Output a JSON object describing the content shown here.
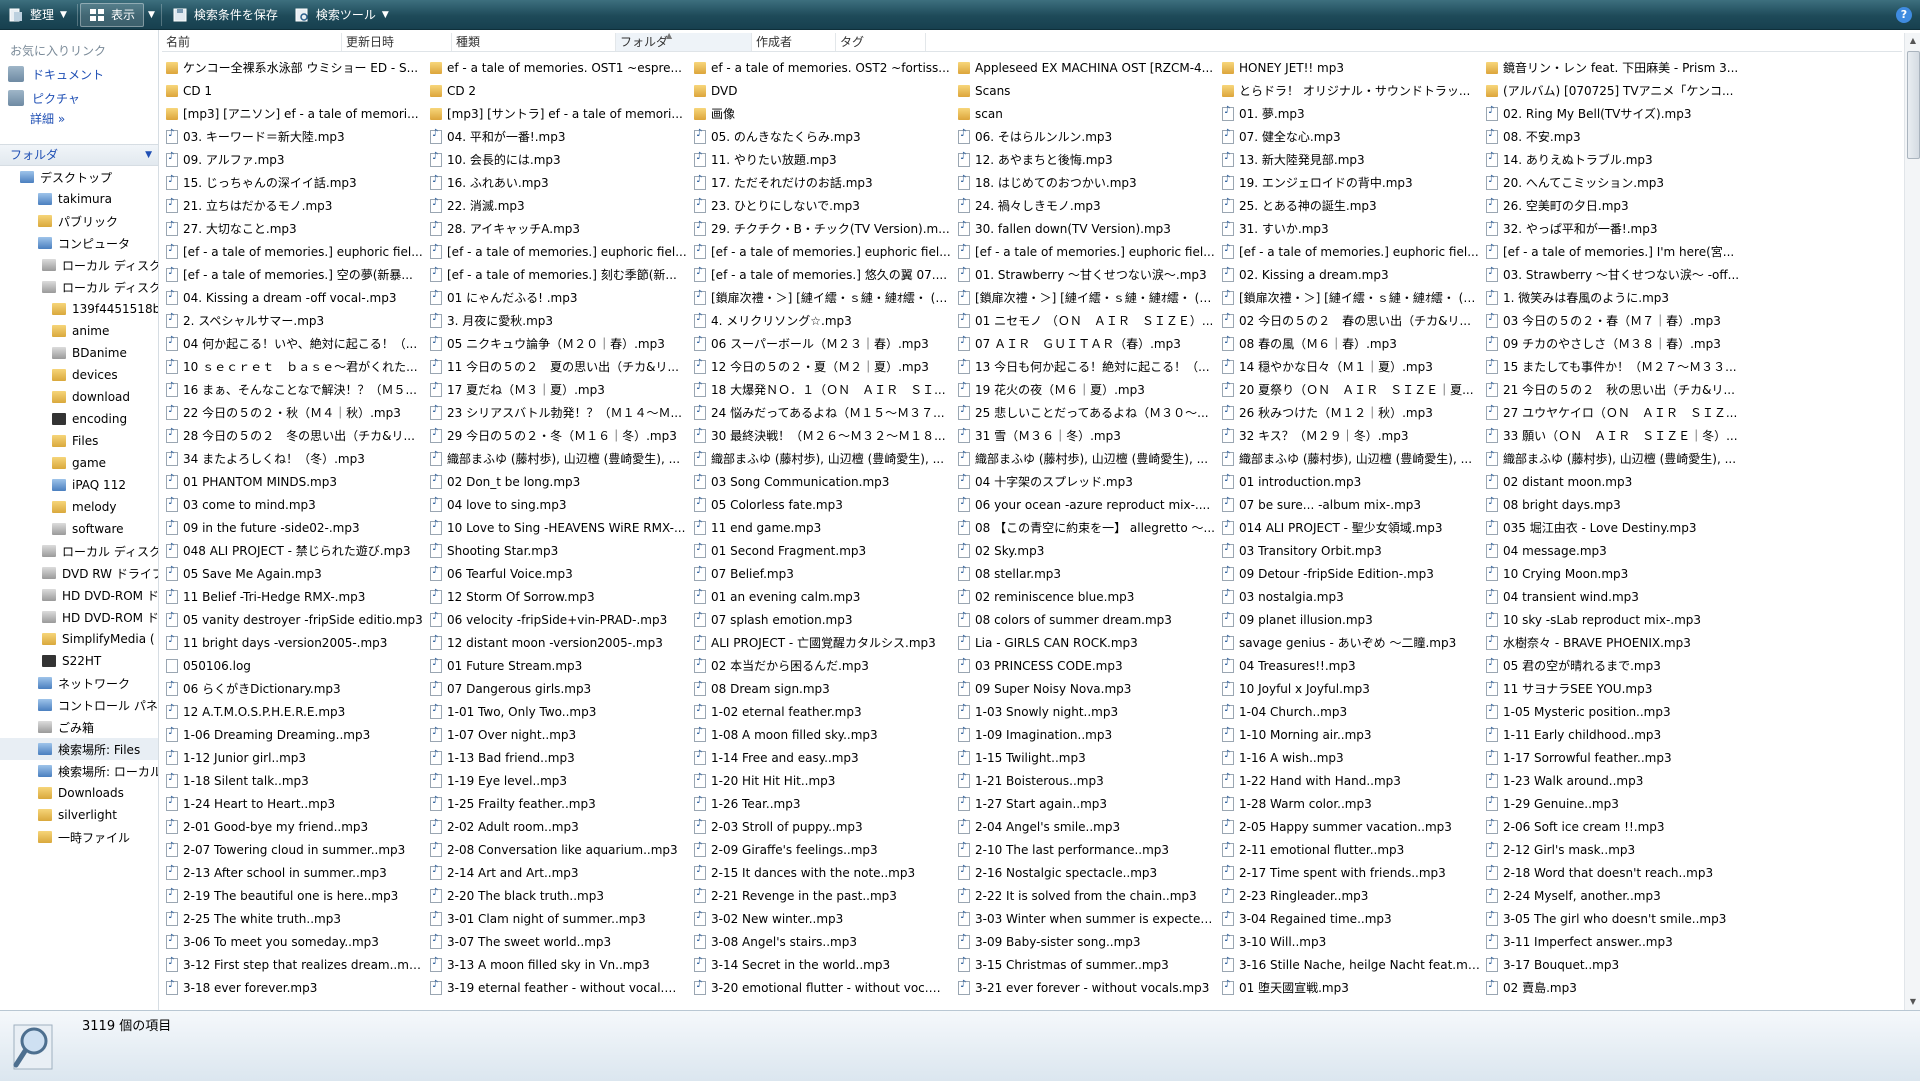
{
  "toolbar": {
    "organize": "整理",
    "view": "表示",
    "save_search": "検索条件を保存",
    "search_tools": "検索ツール"
  },
  "nav": {
    "favorites_title": "お気に入りリンク",
    "favorites": [
      "ドキュメント",
      "ピクチャ"
    ],
    "more": "詳細",
    "folders_title": "フォルダ",
    "tree": [
      {
        "label": "デスクトップ",
        "level": 0,
        "icon": "blue"
      },
      {
        "label": "takimura",
        "level": 1,
        "icon": "blue"
      },
      {
        "label": "パブリック",
        "level": 1,
        "icon": "folder"
      },
      {
        "label": "コンピュータ",
        "level": 1,
        "icon": "blue"
      },
      {
        "label": "ローカル ディスク",
        "level": 2,
        "icon": "gray"
      },
      {
        "label": "ローカル ディスク",
        "level": 2,
        "icon": "gray"
      },
      {
        "label": "139f4451518b",
        "level": 3,
        "icon": "folder"
      },
      {
        "label": "anime",
        "level": 3,
        "icon": "folder"
      },
      {
        "label": "BDanime",
        "level": 3,
        "icon": "gray"
      },
      {
        "label": "devices",
        "level": 3,
        "icon": "folder"
      },
      {
        "label": "download",
        "level": 3,
        "icon": "folder"
      },
      {
        "label": "encoding",
        "level": 3,
        "icon": "dark"
      },
      {
        "label": "Files",
        "level": 3,
        "icon": "folder"
      },
      {
        "label": "game",
        "level": 3,
        "icon": "folder"
      },
      {
        "label": "iPAQ 112",
        "level": 3,
        "icon": "blue"
      },
      {
        "label": "melody",
        "level": 3,
        "icon": "folder"
      },
      {
        "label": "software",
        "level": 3,
        "icon": "gray"
      },
      {
        "label": "ローカル ディスク",
        "level": 2,
        "icon": "gray"
      },
      {
        "label": "DVD RW ドライブ",
        "level": 2,
        "icon": "gray"
      },
      {
        "label": "HD DVD-ROM ドライブ",
        "level": 2,
        "icon": "gray"
      },
      {
        "label": "HD DVD-ROM ドライブ",
        "level": 2,
        "icon": "gray"
      },
      {
        "label": "SimplifyMedia (",
        "level": 2,
        "icon": "folder"
      },
      {
        "label": "S22HT",
        "level": 2,
        "icon": "dark"
      },
      {
        "label": "ネットワーク",
        "level": 1,
        "icon": "blue"
      },
      {
        "label": "コントロール パネル",
        "level": 1,
        "icon": "blue"
      },
      {
        "label": "ごみ箱",
        "level": 1,
        "icon": "gray"
      },
      {
        "label": "検索場所: Files",
        "level": 1,
        "icon": "blue",
        "selected": true
      },
      {
        "label": "検索場所: ローカル",
        "level": 1,
        "icon": "blue"
      },
      {
        "label": "Downloads",
        "level": 1,
        "icon": "folder"
      },
      {
        "label": "silverlight",
        "level": 1,
        "icon": "folder"
      },
      {
        "label": "一時ファイル",
        "level": 1,
        "icon": "folder"
      }
    ]
  },
  "columns": [
    {
      "label": "名前",
      "width": 180
    },
    {
      "label": "更新日時",
      "width": 110
    },
    {
      "label": "種類",
      "width": 164
    },
    {
      "label": "フォルダ",
      "width": 136,
      "sorted": true
    },
    {
      "label": "作成者",
      "width": 84
    },
    {
      "label": "タグ",
      "width": 90
    }
  ],
  "files": [
    [
      "f",
      "ケンコー全裸系水泳部 ウミショー ED - S..."
    ],
    [
      "f",
      "ef - a tale of memories. OST1 ~espre..."
    ],
    [
      "f",
      "ef - a tale of memories. OST2 ~fortiss..."
    ],
    [
      "f",
      "Appleseed EX MACHINA OST [RZCM-4..."
    ],
    [
      "f",
      "HONEY JET!! mp3"
    ],
    [
      "f",
      "鏡音リン・レン feat. 下田麻美 - Prism 3..."
    ],
    [
      "f",
      "CD 1"
    ],
    [
      "f",
      "CD 2"
    ],
    [
      "f",
      "DVD"
    ],
    [
      "f",
      "Scans"
    ],
    [
      "f",
      "とらドラ！ オリジナル・サウンドトラッ..."
    ],
    [
      "f",
      "(アルバム) [070725] TVアニメ「ケンコ..."
    ],
    [
      "f",
      "[mp3] [アニソン] ef - a tale of memori..."
    ],
    [
      "f",
      "[mp3] [サントラ] ef - a tale of memori..."
    ],
    [
      "f",
      "画像"
    ],
    [
      "f",
      "scan"
    ],
    [
      "a",
      "01. 夢.mp3"
    ],
    [
      "a",
      "02. Ring My Bell(TVサイズ).mp3"
    ],
    [
      "a",
      "03. キーワード＝新大陸.mp3"
    ],
    [
      "a",
      "04. 平和が一番!.mp3"
    ],
    [
      "a",
      "05. のんきなたくらみ.mp3"
    ],
    [
      "a",
      "06. そはらルンルン.mp3"
    ],
    [
      "a",
      "07. 健全な心.mp3"
    ],
    [
      "a",
      "08. 不安.mp3"
    ],
    [
      "a",
      "09. アルファ.mp3"
    ],
    [
      "a",
      "10. 会長的には.mp3"
    ],
    [
      "a",
      "11. やりたい放題.mp3"
    ],
    [
      "a",
      "12. あやまちと後悔.mp3"
    ],
    [
      "a",
      "13. 新大陸発見部.mp3"
    ],
    [
      "a",
      "14. ありえぬトラブル.mp3"
    ],
    [
      "a",
      "15. じっちゃんの深イイ話.mp3"
    ],
    [
      "a",
      "16. ふれあい.mp3"
    ],
    [
      "a",
      "17. ただそれだけのお話.mp3"
    ],
    [
      "a",
      "18. はじめてのおつかい.mp3"
    ],
    [
      "a",
      "19. エンジェロイドの背中.mp3"
    ],
    [
      "a",
      "20. へんてこミッション.mp3"
    ],
    [
      "a",
      "21. 立ちはだかるモノ.mp3"
    ],
    [
      "a",
      "22. 消滅.mp3"
    ],
    [
      "a",
      "23. ひとりにしないで.mp3"
    ],
    [
      "a",
      "24. 禍々しきモノ.mp3"
    ],
    [
      "a",
      "25. とある神の誕生.mp3"
    ],
    [
      "a",
      "26. 空美町の夕日.mp3"
    ],
    [
      "a",
      "27. 大切なこと.mp3"
    ],
    [
      "a",
      "28. アイキャッチA.mp3"
    ],
    [
      "a",
      "29. チクチク・B・チック(TV Version).m..."
    ],
    [
      "a",
      "30. fallen down(TV Version).mp3"
    ],
    [
      "a",
      "31. すいか.mp3"
    ],
    [
      "a",
      "32. やっぱ平和が一番!.mp3"
    ],
    [
      "a",
      "[ef - a tale of memories.] euphoric fiel..."
    ],
    [
      "a",
      "[ef - a tale of memories.] euphoric fiel..."
    ],
    [
      "a",
      "[ef - a tale of memories.] euphoric fiel..."
    ],
    [
      "a",
      "[ef - a tale of memories.] euphoric fiel..."
    ],
    [
      "a",
      "[ef - a tale of memories.] euphoric fiel..."
    ],
    [
      "a",
      "[ef - a tale of memories.] I'm here(宮..."
    ],
    [
      "a",
      "[ef - a tale of memories.] 空の夢(新暴..."
    ],
    [
      "a",
      "[ef - a tale of memories.] 刻む季節(新..."
    ],
    [
      "a",
      "[ef - a tale of memories.] 悠久の翼 07...."
    ],
    [
      "a",
      "01. Strawberry ～甘くせつない涙～.mp3"
    ],
    [
      "a",
      "02. Kissing a dream.mp3"
    ],
    [
      "a",
      "03. Strawberry ～甘くせつない涙～ -off..."
    ],
    [
      "a",
      "04. Kissing a dream -off vocal-.mp3"
    ],
    [
      "a",
      "01 にゃんだふる! .mp3"
    ],
    [
      "a",
      "[鎖扉次禮・＞] [縺イ繧・ｓ縺・縺ｵ繧・ (2..."
    ],
    [
      "a",
      "[鎖扉次禮・＞] [縺イ繧・ｓ縺・縺ｵ繧・ (2..."
    ],
    [
      "a",
      "[鎖扉次禮・＞] [縺イ繧・ｓ縺・縺ｵ繧・ (2..."
    ],
    [
      "a",
      "1. 微笑みは春風のように.mp3"
    ],
    [
      "a",
      "2. スペシャルサマー.mp3"
    ],
    [
      "a",
      "3. 月夜に愛秋.mp3"
    ],
    [
      "a",
      "4. メリクリソング☆.mp3"
    ],
    [
      "a",
      "01 ニセモノ （ＯＮ　ＡＩＲ　ＳＩＺＥ）..."
    ],
    [
      "a",
      "02 今日の５の２　春の思い出（チカ&リ..."
    ],
    [
      "a",
      "03 今日の５の２・春（Ｍ７｜春）.mp3"
    ],
    [
      "a",
      "04 何か起こる！いや、絶対に起こる！（..."
    ],
    [
      "a",
      "05 ニクキュウ論争（Ｍ２０｜春）.mp3"
    ],
    [
      "a",
      "06 スーパーボール（Ｍ２３｜春）.mp3"
    ],
    [
      "a",
      "07 ＡＩＲ　ＧＵＩＴＡＲ（春）.mp3"
    ],
    [
      "a",
      "08 春の風（Ｍ６｜春）.mp3"
    ],
    [
      "a",
      "09 チカのやさしさ（Ｍ３８｜春）.mp3"
    ],
    [
      "a",
      "10 ｓｅｃｒｅｔ　ｂａｓｅ～君がくれた..."
    ],
    [
      "a",
      "11 今日の５の２　夏の思い出（チカ&リ..."
    ],
    [
      "a",
      "12 今日の５の２・夏（Ｍ２｜夏）.mp3"
    ],
    [
      "a",
      "13 今日も何か起こる！絶対に起こる！（..."
    ],
    [
      "a",
      "14 穏やかな日々（Ｍ１｜夏）.mp3"
    ],
    [
      "a",
      "15 またしても事件か！（Ｍ２７～Ｍ３３..."
    ],
    [
      "a",
      "16 まぁ、そんなことなで解決！？（Ｍ５..."
    ],
    [
      "a",
      "17 夏だね（Ｍ３｜夏）.mp3"
    ],
    [
      "a",
      "18 大爆発ＮＯ．１（ＯＮ　ＡＩＲ　ＳＩ..."
    ],
    [
      "a",
      "19 花火の夜（Ｍ６｜夏）.mp3"
    ],
    [
      "a",
      "20 夏祭り（ＯＮ　ＡＩＲ　ＳＩＺＥ｜夏..."
    ],
    [
      "a",
      "21 今日の５の２　秋の思い出（チカ&リ..."
    ],
    [
      "a",
      "22 今日の５の２・秋（Ｍ４｜秋）.mp3"
    ],
    [
      "a",
      "23 シリアスバトル勃発！？（Ｍ１４～Ｍ..."
    ],
    [
      "a",
      "24 悩みだってあるよね（Ｍ１５～Ｍ３７..."
    ],
    [
      "a",
      "25 悲しいことだってあるよね（Ｍ３０～..."
    ],
    [
      "a",
      "26 秋みつけた（Ｍ１２｜秋）.mp3"
    ],
    [
      "a",
      "27 ユウヤケイロ（ＯＮ　ＡＩＲ　ＳＩＺ..."
    ],
    [
      "a",
      "28 今日の５の２　冬の思い出（チカ&リ..."
    ],
    [
      "a",
      "29 今日の５の２・冬（Ｍ１６｜冬）.mp3"
    ],
    [
      "a",
      "30 最終決戦！（Ｍ２６～Ｍ３２～Ｍ１８..."
    ],
    [
      "a",
      "31 雪（Ｍ３６｜冬）.mp3"
    ],
    [
      "a",
      "32 キス？（Ｍ２９｜冬）.mp3"
    ],
    [
      "a",
      "33 願い（ＯＮ　ＡＩＲ　ＳＩＺＥ｜冬）..."
    ],
    [
      "a",
      "34 またよろしくね！（冬）.mp3"
    ],
    [
      "a",
      "織部まふゆ (藤村歩), 山辺檀 (豊崎愛生), ..."
    ],
    [
      "a",
      "織部まふゆ (藤村歩), 山辺檀 (豊崎愛生), ..."
    ],
    [
      "a",
      "織部まふゆ (藤村歩), 山辺檀 (豊崎愛生), ..."
    ],
    [
      "a",
      "織部まふゆ (藤村歩), 山辺檀 (豊崎愛生), ..."
    ],
    [
      "a",
      "織部まふゆ (藤村歩), 山辺檀 (豊崎愛生), ..."
    ],
    [
      "a",
      "01 PHANTOM MINDS.mp3"
    ],
    [
      "a",
      "02 Don_t be long.mp3"
    ],
    [
      "a",
      "03 Song Communication.mp3"
    ],
    [
      "a",
      "04 十字架のスプレッド.mp3"
    ],
    [
      "a",
      "01 introduction.mp3"
    ],
    [
      "a",
      "02 distant moon.mp3"
    ],
    [
      "a",
      "03 come to mind.mp3"
    ],
    [
      "a",
      "04 love to sing.mp3"
    ],
    [
      "a",
      "05 Colorless fate.mp3"
    ],
    [
      "a",
      "06 your ocean -azure reproduct mix-...."
    ],
    [
      "a",
      "07 be sure... -album mix-.mp3"
    ],
    [
      "a",
      "08 bright days.mp3"
    ],
    [
      "a",
      "09 in the future -side02-.mp3"
    ],
    [
      "a",
      "10 Love to Sing -HEAVENS WiRE RMX-..."
    ],
    [
      "a",
      "11 end game.mp3"
    ],
    [
      "a",
      "08 【この青空に約束を一】 allegretto ～..."
    ],
    [
      "a",
      "014 ALI PROJECT - 聖少女領域.mp3"
    ],
    [
      "a",
      "035 堀江由衣 - Love Destiny.mp3"
    ],
    [
      "a",
      "048 ALI PROJECT - 禁じられた遊び.mp3"
    ],
    [
      "a",
      "Shooting Star.mp3"
    ],
    [
      "a",
      "01 Second Fragment.mp3"
    ],
    [
      "a",
      "02 Sky.mp3"
    ],
    [
      "a",
      "03 Transitory Orbit.mp3"
    ],
    [
      "a",
      "04 message.mp3"
    ],
    [
      "a",
      "05 Save Me Again.mp3"
    ],
    [
      "a",
      "06 Tearful Voice.mp3"
    ],
    [
      "a",
      "07 Belief.mp3"
    ],
    [
      "a",
      "08 stellar.mp3"
    ],
    [
      "a",
      "09 Detour -fripSide Edition-.mp3"
    ],
    [
      "a",
      "10 Crying Moon.mp3"
    ],
    [
      "a",
      "11 Belief -Tri-Hedge RMX-.mp3"
    ],
    [
      "a",
      "12 Storm Of Sorrow.mp3"
    ],
    [
      "a",
      "01 an evening calm.mp3"
    ],
    [
      "a",
      "02 reminiscence blue.mp3"
    ],
    [
      "a",
      "03 nostalgia.mp3"
    ],
    [
      "a",
      "04 transient wind.mp3"
    ],
    [
      "a",
      "05 vanity destroyer -fripSide editio.mp3"
    ],
    [
      "a",
      "06 velocity -fripSide+vin-PRAD-.mp3"
    ],
    [
      "a",
      "07 splash emotion.mp3"
    ],
    [
      "a",
      "08 colors of summer dream.mp3"
    ],
    [
      "a",
      "09 planet illusion.mp3"
    ],
    [
      "a",
      "10 sky -sLab reproduct mix-.mp3"
    ],
    [
      "a",
      "11 bright days -version2005-.mp3"
    ],
    [
      "a",
      "12 distant moon -version2005-.mp3"
    ],
    [
      "a",
      "ALI PROJECT - 亡國覚醒カタルシス.mp3"
    ],
    [
      "a",
      "Lia - GIRLS CAN ROCK.mp3"
    ],
    [
      "a",
      "savage genius - あいぞめ ～二瞳.mp3"
    ],
    [
      "a",
      "水樹奈々 - BRAVE PHOENIX.mp3"
    ],
    [
      "d",
      "050106.log"
    ],
    [
      "a",
      "01 Future Stream.mp3"
    ],
    [
      "a",
      "02 本当だから困るんだ.mp3"
    ],
    [
      "a",
      "03 PRINCESS CODE.mp3"
    ],
    [
      "a",
      "04 Treasures!!.mp3"
    ],
    [
      "a",
      "05 君の空が晴れるまで.mp3"
    ],
    [
      "a",
      "06 らくがきDictionary.mp3"
    ],
    [
      "a",
      "07 Dangerous girls.mp3"
    ],
    [
      "a",
      "08 Dream sign.mp3"
    ],
    [
      "a",
      "09 Super Noisy Nova.mp3"
    ],
    [
      "a",
      "10 Joyful x Joyful.mp3"
    ],
    [
      "a",
      "11 サヨナラSEE YOU.mp3"
    ],
    [
      "a",
      "12 A.T.M.O.S.P.H.E.R.E.mp3"
    ],
    [
      "a",
      "1-01 Two, Only Two..mp3"
    ],
    [
      "a",
      "1-02 eternal feather.mp3"
    ],
    [
      "a",
      "1-03 Snowly night..mp3"
    ],
    [
      "a",
      "1-04 Church..mp3"
    ],
    [
      "a",
      "1-05 Mysteric position..mp3"
    ],
    [
      "a",
      "1-06 Dreaming Dreaming..mp3"
    ],
    [
      "a",
      "1-07 Over night..mp3"
    ],
    [
      "a",
      "1-08 A moon filled sky..mp3"
    ],
    [
      "a",
      "1-09 Imagination..mp3"
    ],
    [
      "a",
      "1-10 Morning air..mp3"
    ],
    [
      "a",
      "1-11 Early childhood..mp3"
    ],
    [
      "a",
      "1-12 Junior girl..mp3"
    ],
    [
      "a",
      "1-13 Bad friend..mp3"
    ],
    [
      "a",
      "1-14 Free and easy..mp3"
    ],
    [
      "a",
      "1-15 Twilight..mp3"
    ],
    [
      "a",
      "1-16 A wish..mp3"
    ],
    [
      "a",
      "1-17 Sorrowful feather..mp3"
    ],
    [
      "a",
      "1-18 Silent talk..mp3"
    ],
    [
      "a",
      "1-19 Eye level..mp3"
    ],
    [
      "a",
      "1-20 Hit Hit Hit..mp3"
    ],
    [
      "a",
      "1-21 Boisterous..mp3"
    ],
    [
      "a",
      "1-22 Hand with Hand..mp3"
    ],
    [
      "a",
      "1-23 Walk around..mp3"
    ],
    [
      "a",
      "1-24 Heart to Heart..mp3"
    ],
    [
      "a",
      "1-25 Frailty feather..mp3"
    ],
    [
      "a",
      "1-26 Tear..mp3"
    ],
    [
      "a",
      "1-27 Start again..mp3"
    ],
    [
      "a",
      "1-28 Warm color..mp3"
    ],
    [
      "a",
      "1-29 Genuine..mp3"
    ],
    [
      "a",
      "2-01 Good-bye my friend..mp3"
    ],
    [
      "a",
      "2-02 Adult room..mp3"
    ],
    [
      "a",
      "2-03 Stroll of puppy..mp3"
    ],
    [
      "a",
      "2-04 Angel's smile..mp3"
    ],
    [
      "a",
      "2-05 Happy summer vacation..mp3"
    ],
    [
      "a",
      "2-06 Soft ice cream !!.mp3"
    ],
    [
      "a",
      "2-07 Towering cloud in summer..mp3"
    ],
    [
      "a",
      "2-08 Conversation like aquarium..mp3"
    ],
    [
      "a",
      "2-09 Giraffe's feelings..mp3"
    ],
    [
      "a",
      "2-10 The last performance..mp3"
    ],
    [
      "a",
      "2-11 emotional flutter..mp3"
    ],
    [
      "a",
      "2-12 Girl's mask..mp3"
    ],
    [
      "a",
      "2-13 After school in summer..mp3"
    ],
    [
      "a",
      "2-14 Art and Art..mp3"
    ],
    [
      "a",
      "2-15 It dances with the note..mp3"
    ],
    [
      "a",
      "2-16 Nostalgic spectacle..mp3"
    ],
    [
      "a",
      "2-17 Time spent with friends..mp3"
    ],
    [
      "a",
      "2-18 Word that doesn't reach..mp3"
    ],
    [
      "a",
      "2-19 The beautiful one is here..mp3"
    ],
    [
      "a",
      "2-20 The black truth..mp3"
    ],
    [
      "a",
      "2-21 Revenge in the past..mp3"
    ],
    [
      "a",
      "2-22 It is solved from the chain..mp3"
    ],
    [
      "a",
      "2-23 Ringleader..mp3"
    ],
    [
      "a",
      "2-24 Myself, another..mp3"
    ],
    [
      "a",
      "2-25 The white truth..mp3"
    ],
    [
      "a",
      "3-01 Clam night of summer..mp3"
    ],
    [
      "a",
      "3-02 New winter..mp3"
    ],
    [
      "a",
      "3-03 Winter when summer is expected...."
    ],
    [
      "a",
      "3-04 Regained time..mp3"
    ],
    [
      "a",
      "3-05 The girl who doesn't smile..mp3"
    ],
    [
      "a",
      "3-06 To meet you someday..mp3"
    ],
    [
      "a",
      "3-07 The sweet world..mp3"
    ],
    [
      "a",
      "3-08 Angel's stairs..mp3"
    ],
    [
      "a",
      "3-09 Baby-sister song..mp3"
    ],
    [
      "a",
      "3-10 Will..mp3"
    ],
    [
      "a",
      "3-11 Imperfect answer..mp3"
    ],
    [
      "a",
      "3-12 First step that realizes dream..mp3"
    ],
    [
      "a",
      "3-13 A moon filled sky in Vn..mp3"
    ],
    [
      "a",
      "3-14 Secret in the world..mp3"
    ],
    [
      "a",
      "3-15 Christmas of summer..mp3"
    ],
    [
      "a",
      "3-16 Stille Nache, heilge Nacht feat.mp3"
    ],
    [
      "a",
      "3-17 Bouquet..mp3"
    ],
    [
      "a",
      "3-18 ever forever.mp3"
    ],
    [
      "a",
      "3-19 eternal feather - without vocal.mp3"
    ],
    [
      "a",
      "3-20 emotional flutter - without voc.mp3"
    ],
    [
      "a",
      "3-21 ever forever - without vocals.mp3"
    ],
    [
      "a",
      "01 堕天國宣戦.mp3"
    ],
    [
      "a",
      "02 賣島.mp3"
    ]
  ],
  "status": {
    "count": "3119 個の項目"
  }
}
